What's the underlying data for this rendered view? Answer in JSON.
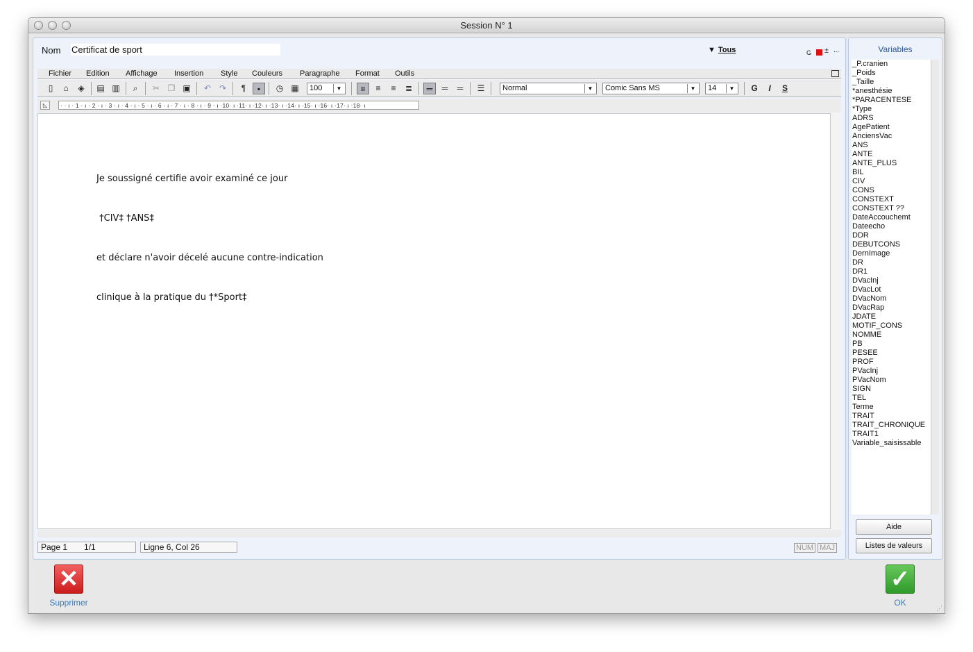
{
  "window": {
    "title": "Session N° 1"
  },
  "header": {
    "nom_label": "Nom",
    "nom_value": "Certificat de sport",
    "filter_label": "Tous",
    "g_mark": "G",
    "plus_minus": "±",
    "more": "..."
  },
  "menu": {
    "items": [
      "Fichier",
      "Edition",
      "Affichage",
      "Insertion",
      "Style",
      "Couleurs",
      "Paragraphe",
      "Format",
      "Outils"
    ]
  },
  "toolbar": {
    "zoom_value": "100",
    "style_value": "Normal",
    "font_value": "Comic Sans MS",
    "size_value": "14",
    "bold_label": "G",
    "italic_label": "I",
    "strike_label": "S",
    "pilcrow": "¶"
  },
  "ruler": {
    "text": "· · ı · 1 · ı · 2 · ı · 3 · ı · 4 · ı · 5 · ı · 6 · ı · 7 · ı · 8 · ı · 9 · ı ·10· ı ·11· ı ·12· ı ·13· ı ·14· ı ·15· ı ·16· ı ·17· ı ·18· ı"
  },
  "document": {
    "lines": [
      "Je soussigné certifie avoir examiné ce jour",
      " †CIV‡ †ANS‡",
      "et déclare n'avoir décelé aucune contre-indication",
      "clinique à la pratique du †*Sport‡"
    ]
  },
  "status": {
    "page": "Page 1",
    "pages": "1/1",
    "position": "Ligne 6, Col 26",
    "num": "NUM",
    "maj": "MAJ"
  },
  "variables": {
    "title": "Variables",
    "items": [
      "_P.cranien",
      "_Poids",
      "_Taille",
      "*anesthésie",
      "*PARACENTESE",
      "*Type",
      "ADRS",
      "AgePatient",
      "AnciensVac",
      "ANS",
      "ANTE",
      "ANTE_PLUS",
      "BIL",
      "CIV",
      "CONS",
      "CONSTEXT",
      "CONSTEXT ??",
      "DateAccouchemt",
      "Dateecho",
      "DDR",
      "DEBUTCONS",
      "DernImage",
      "DR",
      "DR1",
      "DVacInj",
      "DVacLot",
      "DVacNom",
      "DVacRap",
      "JDATE",
      "MOTIF_CONS",
      "NOMME",
      "PB",
      "PESEE",
      "PROF",
      "PVacInj",
      "PVacNom",
      "SIGN",
      "TEL",
      "Terme",
      "TRAIT",
      "TRAIT_CHRONIQUE",
      "TRAIT1",
      "Variable_saisissable"
    ],
    "help_button": "Aide",
    "lists_button": "Listes de valeurs"
  },
  "actions": {
    "delete_label": "Supprimer",
    "ok_label": "OK"
  },
  "colors": {
    "panel_bg": "#eef2fb",
    "accent_blue": "#3a7ab8",
    "delete_red": "#cc1c1c",
    "ok_green": "#2f9a2a"
  }
}
